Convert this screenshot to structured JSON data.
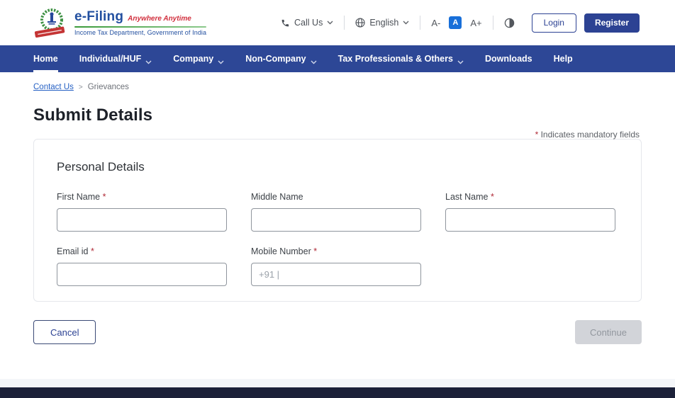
{
  "header": {
    "logo": {
      "brand": "e-Filing",
      "tagline": "Anywhere Anytime",
      "subtitle": "Income Tax Department, Government of India"
    },
    "call_us_label": "Call Us",
    "language_label": "English",
    "font_controls": {
      "decrease": "A-",
      "normal": "A",
      "increase": "A+"
    },
    "login_label": "Login",
    "register_label": "Register"
  },
  "navbar": {
    "items": [
      {
        "label": "Home",
        "dropdown": false,
        "active": true
      },
      {
        "label": "Individual/HUF",
        "dropdown": true,
        "active": false
      },
      {
        "label": "Company",
        "dropdown": true,
        "active": false
      },
      {
        "label": "Non-Company",
        "dropdown": true,
        "active": false
      },
      {
        "label": "Tax Professionals & Others",
        "dropdown": true,
        "active": false
      },
      {
        "label": "Downloads",
        "dropdown": false,
        "active": false
      },
      {
        "label": "Help",
        "dropdown": false,
        "active": false
      }
    ]
  },
  "breadcrumb": {
    "items": [
      "Contact Us",
      "Grievances"
    ],
    "separator": ">"
  },
  "page": {
    "title": "Submit Details",
    "asterisk": "*",
    "mandatory_note": "Indicates mandatory fields"
  },
  "form": {
    "section_title": "Personal Details",
    "fields": [
      {
        "label": "First Name",
        "required": true,
        "value": "",
        "placeholder": ""
      },
      {
        "label": "Middle Name",
        "required": false,
        "value": "",
        "placeholder": ""
      },
      {
        "label": "Last Name",
        "required": true,
        "value": "",
        "placeholder": ""
      },
      {
        "label": "Email id",
        "required": true,
        "value": "",
        "placeholder": ""
      },
      {
        "label": "Mobile Number",
        "required": true,
        "value": "",
        "placeholder": "+91 |"
      }
    ]
  },
  "actions": {
    "cancel_label": "Cancel",
    "continue_label": "Continue",
    "continue_disabled": true
  },
  "icons": {
    "phone-icon": "phone receiver glyph",
    "globe-icon": "globe circle with meridians",
    "chevron-down-icon": "caret down",
    "contrast-icon": "half filled circle",
    "emblem-icon": "national emblem in green wreath with red ribbon"
  },
  "colors": {
    "navbar": "#2d4796",
    "accent_navy": "#2c4293",
    "font_size_active": "#186fd9",
    "breadcrumb_link": "#2661c4",
    "required_red": "#b02a37",
    "footer_dark": "#1c2139",
    "disabled_bg": "#d2d4d9",
    "logo_blue": "#2350a0",
    "logo_red": "#d12f3d",
    "logo_green": "#3a9a3a"
  }
}
